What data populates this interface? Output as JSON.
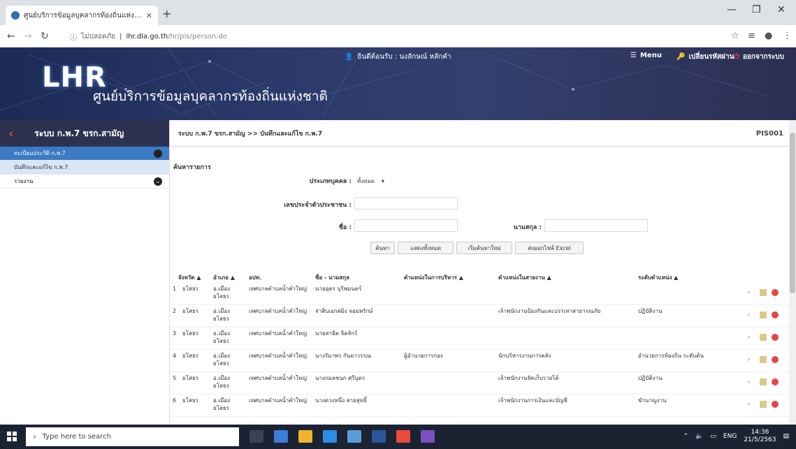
{
  "browser": {
    "tab_title": "ศูนย์บริการข้อมูลบุคลากรท้องถิ่นแห่งชาติ",
    "tab_close": "✕",
    "new_tab": "+",
    "url_security": "ไม่ปลอดภัย",
    "url_host": "lhr.dla.go.th",
    "url_path": "/hr/pis/person.do"
  },
  "header": {
    "logo": "LHR",
    "site_title": "ศูนย์บริการข้อมูลบุคลากรท้องถิ่นแห่งชาติ",
    "greeting": "ยินดีต้อนรับ : นงลักษณ์ หลักคำ",
    "menu_label": "Menu",
    "change_password_label": "เปลี่ยนรหัสผ่าน",
    "logout_label": "ออกจากระบบ"
  },
  "sidebar": {
    "title": "ระบบ ก.พ.7 ขรก.สามัญ",
    "items": [
      {
        "label": "ทะเบียนประวัติ ก.พ.7"
      },
      {
        "label": "บันทึกและแก้ไข ก.พ.7"
      },
      {
        "label": "รายงาน"
      }
    ]
  },
  "page": {
    "breadcrumb": "ระบบ ก.พ.7 ขรก.สามัญ >> บันทึกและแก้ไข ก.พ.7",
    "code": "PIS001",
    "section_title": "ค้นหารายการ"
  },
  "search_form": {
    "person_type_label": "ประเภทบุคคล :",
    "person_type_value": "ทั้งหมด",
    "citizen_id_label": "เลขประจำตัวประชาชน :",
    "citizen_id_value": "",
    "first_name_label": "ชื่อ :",
    "first_name_value": "",
    "last_name_label": "นามสกุล :",
    "last_name_value": "",
    "buttons": [
      "ค้นหา",
      "แสดงทั้งหมด",
      "เริ่มค้นหาใหม่",
      "ส่งออกไฟล์ Excel"
    ]
  },
  "table": {
    "headers": [
      "จังหวัด ▲",
      "อำเภอ ▲",
      "อปท.",
      "ชื่อ - นามสกุล",
      "ตำแหน่งในการบริหาร ▲",
      "ตำแหน่งในสายงาน ▲",
      "ระดับตำแหน่ง ▲"
    ],
    "rows": [
      {
        "no": "1",
        "province": "ยโสธร",
        "district": "อ.เมือง ยโสธร",
        "org": "เทศบาลตำบลน้ำคำใหญ่",
        "name": "นายอุดร บุริพมนตร์",
        "admin_pos": "",
        "line_pos": "",
        "level": ""
      },
      {
        "no": "2",
        "province": "ยโสธร",
        "district": "อ.เมือง ยโสธร",
        "org": "เทศบาลตำบลน้ำคำใหญ่",
        "name": "จ่าสิบเอกสมิง จอมพรักษ์",
        "admin_pos": "",
        "line_pos": "เจ้าพนักงานป้องกันและบรรเทาสาธารณภัย",
        "level": "ปฏิบัติงาน"
      },
      {
        "no": "3",
        "province": "ยโสธร",
        "district": "อ.เมือง ยโสธร",
        "org": "เทศบาลตำบลน้ำคำใหญ่",
        "name": "นายสาธิต จิตจักร์",
        "admin_pos": "",
        "line_pos": "",
        "level": ""
      },
      {
        "no": "4",
        "province": "ยโสธร",
        "district": "อ.เมือง ยโสธร",
        "org": "เทศบาลตำบลน้ำคำใหญ่",
        "name": "นางรัมาพร กันยาวรรณ",
        "admin_pos": "ผู้อำนวยการกอง",
        "line_pos": "นักบริหารงานการคลัง",
        "level": "อำนวยการท้องถิ่น ระดับต้น"
      },
      {
        "no": "5",
        "province": "ยโสธร",
        "district": "อ.เมือง ยโสธร",
        "org": "เทศบาลตำบลน้ำคำใหญ่",
        "name": "นางกมลชนก ศรีบุตร",
        "admin_pos": "",
        "line_pos": "เจ้าพนักงานจัดเก็บรายได้",
        "level": "ปฏิบัติงาน"
      },
      {
        "no": "6",
        "province": "ยโสธร",
        "district": "อ.เมือง ยโสธร",
        "org": "เทศบาลตำบลน้ำคำใหญ่",
        "name": "นางดวงหนึ่ง สายสุทธิ์",
        "admin_pos": "",
        "line_pos": "เจ้าพนักงานการเงินและบัญชี",
        "level": "ชำนาญงาน"
      }
    ]
  },
  "taskbar": {
    "search_placeholder": "Type here to search",
    "lang": "ENG",
    "time": "14:36",
    "date": "21/5/2563"
  },
  "colors": {
    "header_bg": "#2b3a6b",
    "sidebar_head": "#2d3150",
    "sidebar_active": "#3c7ac4",
    "sidebar_sub": "#d8e6f6",
    "logout": "#e5453b",
    "taskbar": "#1b2333"
  }
}
